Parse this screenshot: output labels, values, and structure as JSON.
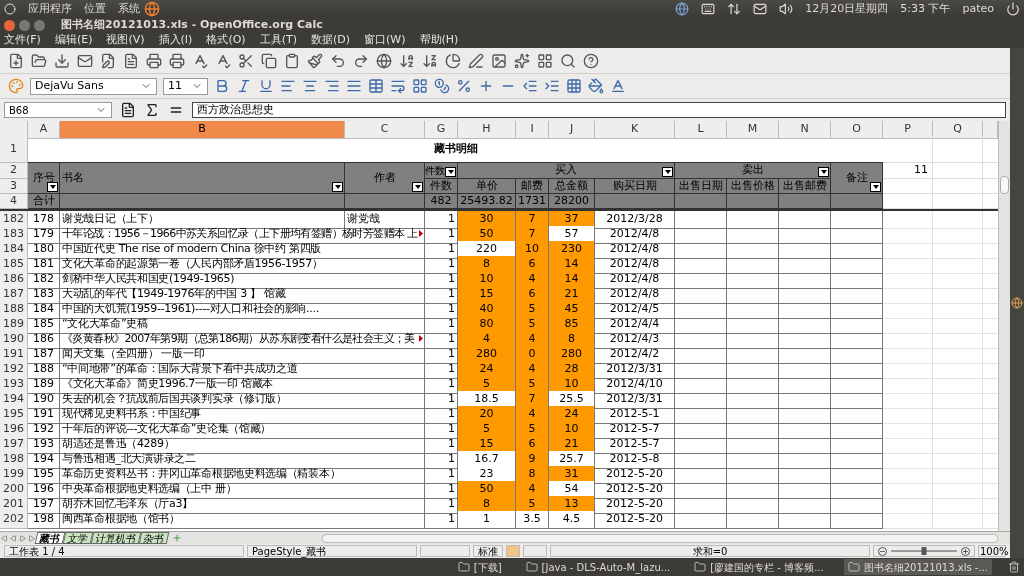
{
  "top_panel": {
    "menus": [
      "应用程序",
      "位置",
      "系统"
    ],
    "date": "12月20日星期四",
    "time": "5:33 下午",
    "user": "pateo"
  },
  "window": {
    "title": "图书名细20121013.xls - OpenOffice.org Calc"
  },
  "menu": [
    "文件(F)",
    "编辑(E)",
    "视图(V)",
    "插入(I)",
    "格式(O)",
    "工具(T)",
    "数据(D)",
    "窗口(W)",
    "帮助(H)"
  ],
  "format_bar": {
    "font": "DejaVu Sans",
    "size": "11"
  },
  "formula_bar": {
    "cell": "B68",
    "content": "西方政治思想史"
  },
  "sheet": {
    "columns": [
      {
        "label": "A",
        "selected": false
      },
      {
        "label": "B",
        "selected": true
      },
      {
        "label": "C",
        "selected": false
      },
      {
        "label": "G",
        "selected": false
      },
      {
        "label": "H",
        "selected": false
      },
      {
        "label": "I",
        "selected": false
      },
      {
        "label": "J",
        "selected": false
      },
      {
        "label": "K",
        "selected": false
      },
      {
        "label": "L",
        "selected": false
      },
      {
        "label": "M",
        "selected": false
      },
      {
        "label": "N",
        "selected": false
      },
      {
        "label": "O",
        "selected": false
      },
      {
        "label": "P",
        "selected": false
      },
      {
        "label": "Q",
        "selected": false
      }
    ],
    "row_numbers": [
      "1",
      "2",
      "3",
      "4"
    ],
    "header": {
      "title": "藏书明细",
      "seq": "序号",
      "name": "书名",
      "author": "作者",
      "count_group": "件数",
      "buy_group": "买入",
      "sell_group": "卖出",
      "note": "备注",
      "count": "件数",
      "price": "单价",
      "postage": "邮费",
      "total": "总金额",
      "buy_date": "购买日期",
      "sell_date": "出售日期",
      "sell_price": "出售价格",
      "sell_postage": "出售邮费",
      "cell_p2": "11"
    },
    "totals": {
      "label": "合计",
      "count": "482",
      "price": "25493.82",
      "postage": "1731",
      "total": "28200"
    },
    "rows": [
      {
        "row": "182",
        "seq": "178",
        "title": "谢党哉日记（上下）",
        "author": "谢党哉",
        "count": "1",
        "price": "30",
        "postage": "7",
        "total": "37",
        "date": "2012/3/28",
        "marked": [
          true,
          true,
          true
        ],
        "overflow": false
      },
      {
        "row": "183",
        "seq": "179",
        "title": "十年论战：1956－1966中苏关系回忆录（上下册均有签赠）杨时芳签赠本 上",
        "count": "1",
        "price": "50",
        "postage": "7",
        "total": "57",
        "date": "2012/4/8",
        "marked": [
          true,
          true,
          false
        ],
        "overflow": true
      },
      {
        "row": "184",
        "seq": "180",
        "title": "中国近代史 The rise of modern China 徐中约 第四版",
        "count": "1",
        "price": "220",
        "postage": "10",
        "total": "230",
        "date": "2012/4/8",
        "marked": [
          false,
          true,
          true
        ],
        "overflow": false
      },
      {
        "row": "185",
        "seq": "181",
        "title": "文化大革命的起源第一卷（人民内部矛盾1956-1957）",
        "count": "1",
        "price": "8",
        "postage": "6",
        "total": "14",
        "date": "2012/4/8",
        "marked": [
          true,
          true,
          true
        ],
        "overflow": false
      },
      {
        "row": "186",
        "seq": "182",
        "title": "剑桥中华人民共和国史(1949-1965)",
        "count": "1",
        "price": "10",
        "postage": "4",
        "total": "14",
        "date": "2012/4/8",
        "marked": [
          true,
          true,
          true
        ],
        "overflow": false
      },
      {
        "row": "187",
        "seq": "183",
        "title": "大动乱的年代【1949-1976年的中国 3 】 馆藏",
        "count": "1",
        "price": "15",
        "postage": "6",
        "total": "21",
        "date": "2012/4/8",
        "marked": [
          true,
          true,
          true
        ],
        "overflow": false
      },
      {
        "row": "188",
        "seq": "184",
        "title": "中国的大饥荒(1959--1961)----对人口和社会的影响....",
        "count": "1",
        "price": "40",
        "postage": "5",
        "total": "45",
        "date": "2012/4/5",
        "marked": [
          true,
          true,
          true
        ],
        "overflow": false
      },
      {
        "row": "189",
        "seq": "185",
        "title": "“文化大革命”史稿",
        "count": "1",
        "price": "80",
        "postage": "5",
        "total": "85",
        "date": "2012/4/4",
        "marked": [
          true,
          true,
          true
        ],
        "overflow": false
      },
      {
        "row": "190",
        "seq": "186",
        "title": "《炎黄春秋》2007年第9期（总第186期）从苏东剧变看什么是社会主义；美",
        "count": "1",
        "price": "4",
        "postage": "4",
        "total": "8",
        "date": "2012/4/3",
        "marked": [
          true,
          true,
          true
        ],
        "overflow": true
      },
      {
        "row": "191",
        "seq": "187",
        "title": "闻天文集（全四册） 一版一印",
        "count": "1",
        "price": "280",
        "postage": "0",
        "total": "280",
        "date": "2012/4/2",
        "marked": [
          true,
          true,
          true
        ],
        "overflow": false
      },
      {
        "row": "192",
        "seq": "188",
        "title": "“中间地带”的革命：国际大背景下看中共成功之道",
        "count": "1",
        "price": "24",
        "postage": "4",
        "total": "28",
        "date": "2012/3/31",
        "marked": [
          true,
          true,
          true
        ],
        "overflow": false
      },
      {
        "row": "193",
        "seq": "189",
        "title": "《文化大革命》简史1996.7一版一印 馆藏本",
        "count": "1",
        "price": "5",
        "postage": "5",
        "total": "10",
        "date": "2012/4/10",
        "marked": [
          true,
          true,
          true
        ],
        "overflow": false
      },
      {
        "row": "194",
        "seq": "190",
        "title": "失去的机会？抗战前后国共谈判实录（修订版）",
        "count": "1",
        "price": "18.5",
        "postage": "7",
        "total": "25.5",
        "date": "2012/3/31",
        "marked": [
          false,
          true,
          false
        ],
        "overflow": false
      },
      {
        "row": "195",
        "seq": "191",
        "title": "现代稀见史料书系：中国纪事",
        "count": "1",
        "price": "20",
        "postage": "4",
        "total": "24",
        "date": "2012-5-1",
        "marked": [
          true,
          true,
          true
        ],
        "overflow": false
      },
      {
        "row": "196",
        "seq": "192",
        "title": "十年后的评说---文化大革命”史论集（馆藏）",
        "count": "1",
        "price": "5",
        "postage": "5",
        "total": "10",
        "date": "2012-5-7",
        "marked": [
          true,
          true,
          true
        ],
        "overflow": false
      },
      {
        "row": "197",
        "seq": "193",
        "title": "胡适还是鲁迅（4289）",
        "count": "1",
        "price": "15",
        "postage": "6",
        "total": "21",
        "date": "2012-5-7",
        "marked": [
          true,
          true,
          true
        ],
        "overflow": false
      },
      {
        "row": "198",
        "seq": "194",
        "title": "与鲁迅相遇_北大演讲录之二",
        "count": "1",
        "price": "16.7",
        "postage": "9",
        "total": "25.7",
        "date": "2012-5-8",
        "marked": [
          false,
          true,
          false
        ],
        "overflow": false
      },
      {
        "row": "199",
        "seq": "195",
        "title": "革命历史资料丛书：井冈山革命根据地史料选编（精装本）",
        "count": "1",
        "price": "23",
        "postage": "8",
        "total": "31",
        "date": "2012-5-20",
        "marked": [
          false,
          true,
          true
        ],
        "overflow": false
      },
      {
        "row": "200",
        "seq": "196",
        "title": "中央革命根据地史料选编（上中 册）",
        "count": "1",
        "price": "50",
        "postage": "4",
        "total": "54",
        "date": "2012-5-20",
        "marked": [
          true,
          true,
          false
        ],
        "overflow": false
      },
      {
        "row": "201",
        "seq": "197",
        "title": "胡乔木回忆毛泽东（厅a3】",
        "count": "1",
        "price": "8",
        "postage": "5",
        "total": "13",
        "date": "2012-5-20",
        "marked": [
          true,
          true,
          true
        ],
        "overflow": false
      },
      {
        "row": "202",
        "seq": "198",
        "title": "闽西革命根据地（馆书）",
        "count": "1",
        "price": "1",
        "postage": "3.5",
        "total": "4.5",
        "date": "2012-5-20",
        "marked": [
          false,
          false,
          false
        ],
        "overflow": false
      }
    ]
  },
  "sheet_tabs": [
    {
      "label": "藏书",
      "selected": true
    },
    {
      "label": "文学",
      "selected": false
    },
    {
      "label": "计算机书",
      "selected": false
    },
    {
      "label": "杂书",
      "selected": false
    }
  ],
  "status_bar": {
    "sheet": "工作表 1 / 4",
    "page_style": "PageStyle_藏书",
    "mode": "标准",
    "sum": "求和=0",
    "zoom": "100%",
    "zoom_slider": {
      "level": 0.5
    }
  },
  "taskbar": [
    {
      "label": "[下载]",
      "selected": false
    },
    {
      "label": "[Java - DLS-Auto-M_lazu...",
      "selected": false
    },
    {
      "label": "[廖建国的专栏 - 博客频...",
      "selected": false
    },
    {
      "label": "图书名细20121013.xls -...",
      "selected": true
    }
  ]
}
